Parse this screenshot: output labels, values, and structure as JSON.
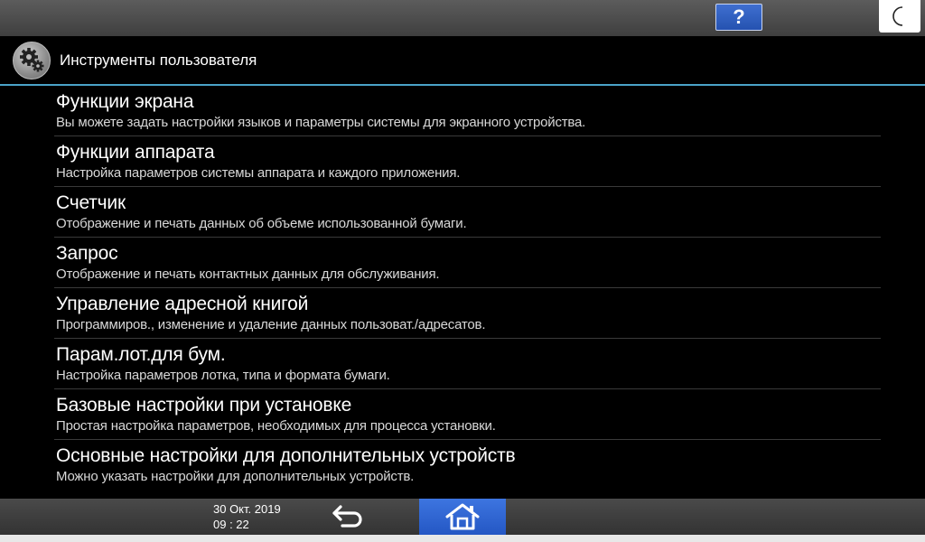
{
  "header": {
    "help_label": "?",
    "energy_icon": "moon-icon"
  },
  "titlebar": {
    "title": "Инструменты пользователя",
    "icon": "gear-icon"
  },
  "menu": {
    "items": [
      {
        "title": "Функции экрана",
        "desc": "Вы можете задать настройки языков и параметры системы для экранного устройства."
      },
      {
        "title": "Функции аппарата",
        "desc": "Настройка параметров системы аппарата и каждого приложения."
      },
      {
        "title": "Счетчик",
        "desc": "Отображение и печать данных об объеме использованной бумаги."
      },
      {
        "title": "Запрос",
        "desc": "Отображение и печать контактных данных для обслуживания."
      },
      {
        "title": "Управление адресной книгой",
        "desc": "Программиров., изменение и удаление данных пользоват./адресатов."
      },
      {
        "title": "Парам.лот.для бум.",
        "desc": "Настройка параметров лотка, типа и формата бумаги."
      },
      {
        "title": "Базовые настройки при установке",
        "desc": "Простая настройка параметров, необходимых для процесса установки."
      },
      {
        "title": "Основные настройки для дополнительных устройств",
        "desc": "Можно указать настройки для дополнительных устройств."
      }
    ]
  },
  "footer": {
    "date": "30 Окт. 2019",
    "time": "09 : 22",
    "back_icon": "back-arrow-icon",
    "home_icon": "home-icon",
    "accent_color": "#2d62d0"
  }
}
